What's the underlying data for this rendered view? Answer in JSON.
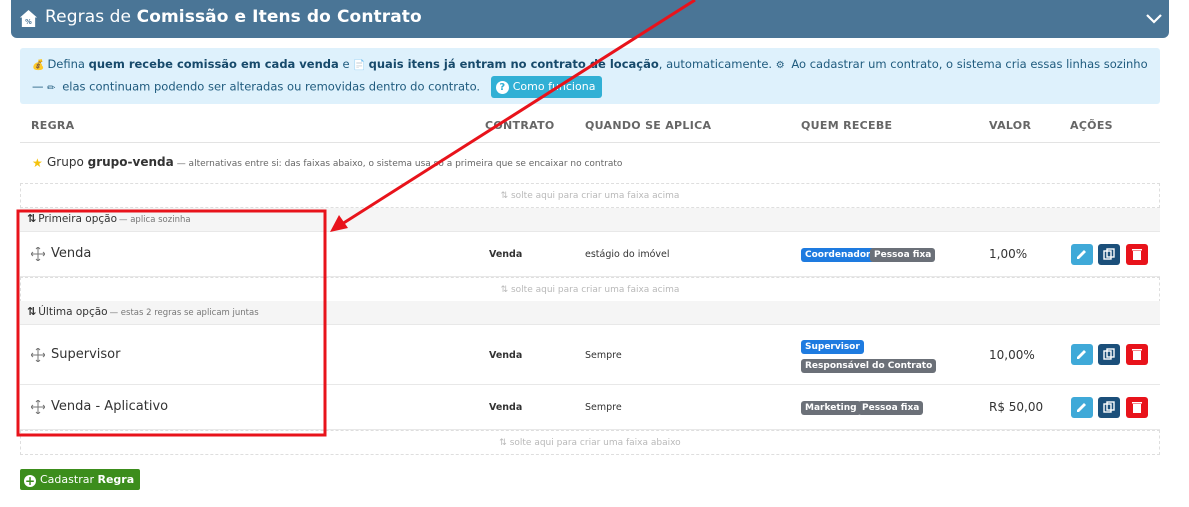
{
  "header": {
    "title_prefix": "Regras de ",
    "title_bold": "Comissão e Itens do Contrato"
  },
  "info": {
    "t1": "Defina ",
    "b1": "quem recebe comissão em cada venda",
    "t2": " e ",
    "b2": "quais itens já entram no contrato de locação",
    "t3": ", automaticamente. ",
    "t4": " Ao cadastrar um contrato, o sistema cria essas linhas sozinho — ",
    "t5": " elas continuam podendo ser alteradas ou removidas dentro do contrato.",
    "button_label": "Como funciona",
    "icons": [
      "money-bag-icon",
      "document-icon",
      "gear-icon",
      "pencil-icon"
    ]
  },
  "table": {
    "headers": {
      "regra": "REGRA",
      "contrato": "CONTRATO",
      "quando": "QUANDO SE APLICA",
      "quem": "QUEM RECEBE",
      "valor": "VALOR",
      "acoes": "AÇÕES"
    },
    "group": {
      "prefix": "Grupo ",
      "name": "grupo-venda",
      "desc": "— alternativas entre si: das faixas abaixo, o sistema usa só a primeira que se encaixar no contrato"
    },
    "drop_above": "⇅ solte aqui para criar uma faixa acima",
    "drop_below": "⇅ solte aqui para criar uma faixa abaixo",
    "options": [
      {
        "label": "Primeira opção",
        "desc": "— aplica sozinha"
      },
      {
        "label": "Última opção",
        "desc": "— estas 2 regras se aplicam juntas"
      }
    ],
    "rows": [
      {
        "name": "Venda",
        "contrato": "Venda",
        "quando": "estágio do imóvel",
        "badges": [
          "Coordenador",
          "Pessoa fixa"
        ],
        "valor": "1,00%"
      },
      {
        "name": "Supervisor",
        "contrato": "Venda",
        "quando": "Sempre",
        "badges": [
          "Supervisor",
          "Responsável do Contrato"
        ],
        "valor": "10,00%"
      },
      {
        "name": "Venda - Aplicativo",
        "contrato": "Venda",
        "quando": "Sempre",
        "badges": [
          "Marketing",
          "Pessoa fixa"
        ],
        "valor": "R$ 50,00"
      }
    ]
  },
  "footer": {
    "add_prefix": "Cadastrar ",
    "add_bold": "Regra"
  },
  "colors": {
    "header": "#4a7596",
    "info_bg": "#def1fc",
    "badge_blue": "#1e7be0",
    "badge_gray": "#6b7078",
    "annotation": "#e8131b"
  }
}
